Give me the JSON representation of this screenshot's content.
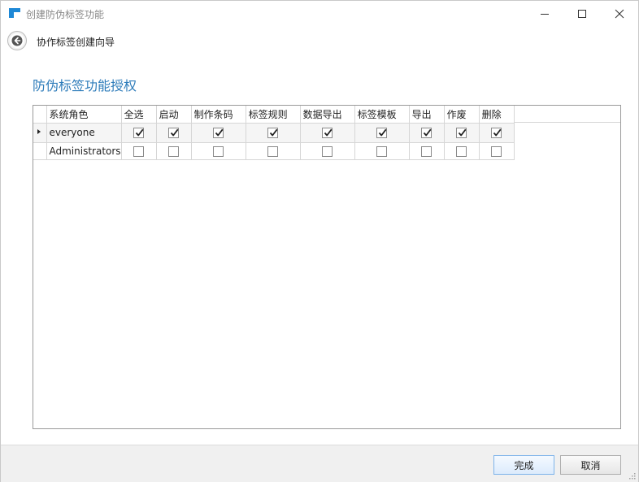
{
  "window": {
    "title": "创建防伪标签功能",
    "accent": "#1e88d6"
  },
  "wizard": {
    "back_icon": "arrow-left-icon",
    "title": "协作标签创建向导"
  },
  "section": {
    "title": "防伪标签功能授权"
  },
  "grid": {
    "columns": [
      "系统角色",
      "全选",
      "启动",
      "制作条码",
      "标签规则",
      "数据导出",
      "标签模板",
      "导出",
      "作废",
      "删除"
    ],
    "rows": [
      {
        "role": "everyone",
        "selected": true,
        "checks": [
          true,
          true,
          true,
          true,
          true,
          true,
          true,
          true,
          true
        ]
      },
      {
        "role": "Administrators",
        "selected": false,
        "checks": [
          false,
          false,
          false,
          false,
          false,
          false,
          false,
          false,
          false
        ]
      }
    ]
  },
  "footer": {
    "finish_label": "完成",
    "cancel_label": "取消"
  }
}
